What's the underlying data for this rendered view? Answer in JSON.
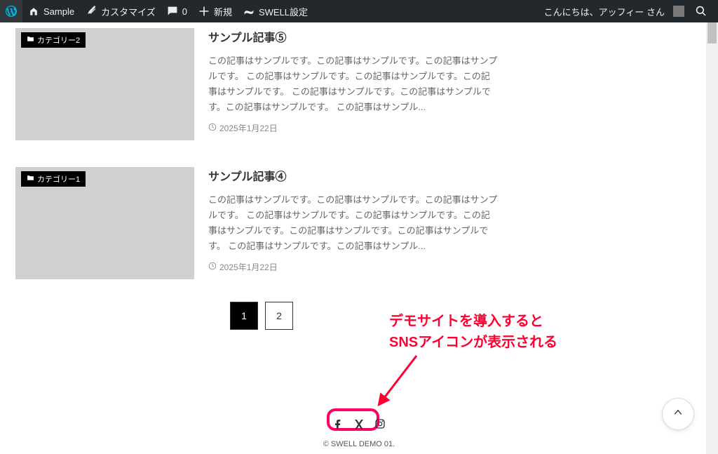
{
  "adminbar": {
    "site_name": "Sample",
    "customize": "カスタマイズ",
    "comments_count": "0",
    "new_label": "新規",
    "swell_settings": "SWELL設定",
    "greeting": "こんにちは、アッフィー さん"
  },
  "posts": [
    {
      "category": "カテゴリー2",
      "title": "サンプル記事⑤",
      "excerpt": "この記事はサンプルです。この記事はサンプルです。この記事はサンプルです。 この記事はサンプルです。この記事はサンプルです。この記事はサンプルです。 この記事はサンプルです。この記事はサンプルです。この記事はサンプルです。 この記事はサンプル...",
      "date": "2025年1月22日"
    },
    {
      "category": "カテゴリー1",
      "title": "サンプル記事④",
      "excerpt": "この記事はサンプルです。この記事はサンプルです。この記事はサンプルです。 この記事はサンプルです。この記事はサンプルです。この記事はサンプルです。この記事はサンプルです。この記事はサンプルです。 この記事はサンプルです。この記事はサンプル...",
      "date": "2025年1月22日"
    }
  ],
  "pagination": {
    "pages": [
      "1",
      "2"
    ],
    "current": "1"
  },
  "annotation": {
    "line1": "デモサイトを導入すると",
    "line2": "SNSアイコンが表示される"
  },
  "footer": {
    "copyright": "© SWELL DEMO 01."
  }
}
